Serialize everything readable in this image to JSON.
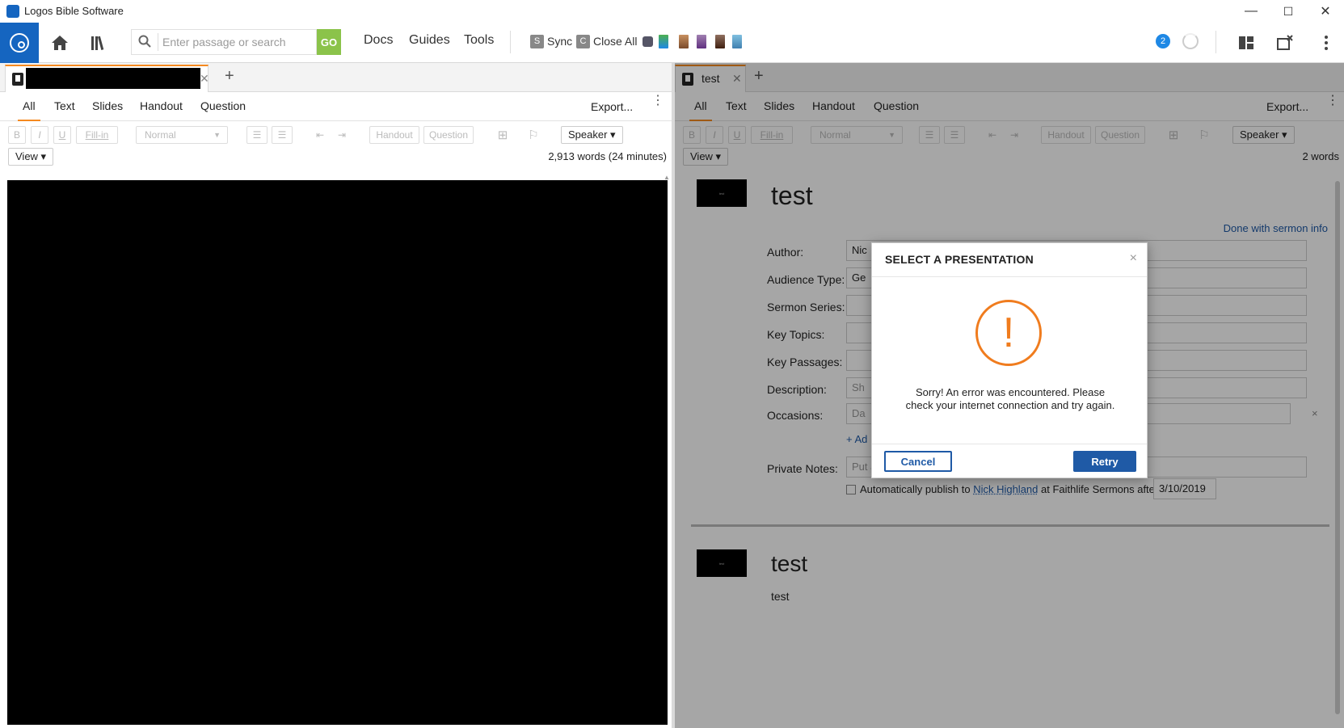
{
  "window": {
    "title": "Logos Bible Software",
    "minimize": "—",
    "maximize": "☐",
    "close": "✕"
  },
  "toolbar": {
    "search_placeholder": "Enter passage or search",
    "go_label": "GO",
    "nav": [
      "Docs",
      "Guides",
      "Tools"
    ],
    "sync_key": "S",
    "sync_label": "Sync",
    "closeall_key": "C",
    "closeall_label": "Close All",
    "notification_count": "2"
  },
  "left_panel": {
    "tab_title": "",
    "view_tabs": [
      "All",
      "Text",
      "Slides",
      "Handout",
      "Question"
    ],
    "export_label": "Export...",
    "format": {
      "bold": "B",
      "italic": "I",
      "underline": "U",
      "fillin": "Fill-in",
      "style": "Normal",
      "handout": "Handout",
      "question": "Question",
      "speaker": "Speaker ▾"
    },
    "view_label": "View ▾",
    "word_count": "2,913 words (24 minutes)"
  },
  "right_panel": {
    "tab_title": "test",
    "view_tabs": [
      "All",
      "Text",
      "Slides",
      "Handout",
      "Question"
    ],
    "export_label": "Export...",
    "format": {
      "bold": "B",
      "italic": "I",
      "underline": "U",
      "fillin": "Fill-in",
      "style": "Normal",
      "handout": "Handout",
      "question": "Question",
      "speaker": "Speaker ▾"
    },
    "view_label": "View ▾",
    "word_count": "2 words",
    "sermon": {
      "title": "test",
      "thumb_text": "test",
      "done_link": "Done with sermon info",
      "fields": [
        {
          "label": "Author:",
          "value": "Nic"
        },
        {
          "label": "Audience Type:",
          "value": "Ge"
        },
        {
          "label": "Sermon Series:",
          "value": ""
        },
        {
          "label": "Key Topics:",
          "value": ""
        },
        {
          "label": "Key Passages:",
          "value": ""
        },
        {
          "label": "Description:",
          "value": "Sh"
        },
        {
          "label": "Occasions:",
          "value": "Da"
        }
      ],
      "add_link": "+ Ad",
      "private_notes_label": "Private Notes:",
      "private_notes_placeholder": "Put additional cataloging information here...",
      "publish_prefix": "Automatically publish to ",
      "publish_user": "Nick Highland",
      "publish_suffix": " at Faithlife Sermons after",
      "publish_date": "3/10/2019",
      "section_title": "test",
      "section_body": "test"
    }
  },
  "modal": {
    "title": "SELECT A PRESENTATION",
    "close": "×",
    "icon": "!",
    "message": "Sorry! An error was encountered. Please check your internet connection and try again.",
    "cancel": "Cancel",
    "retry": "Retry"
  },
  "colors": {
    "brand": "#1565c0",
    "accent": "#f5891f",
    "go": "#8bc34a",
    "warning": "#f07c1e",
    "primary_button": "#1f5aa6"
  }
}
